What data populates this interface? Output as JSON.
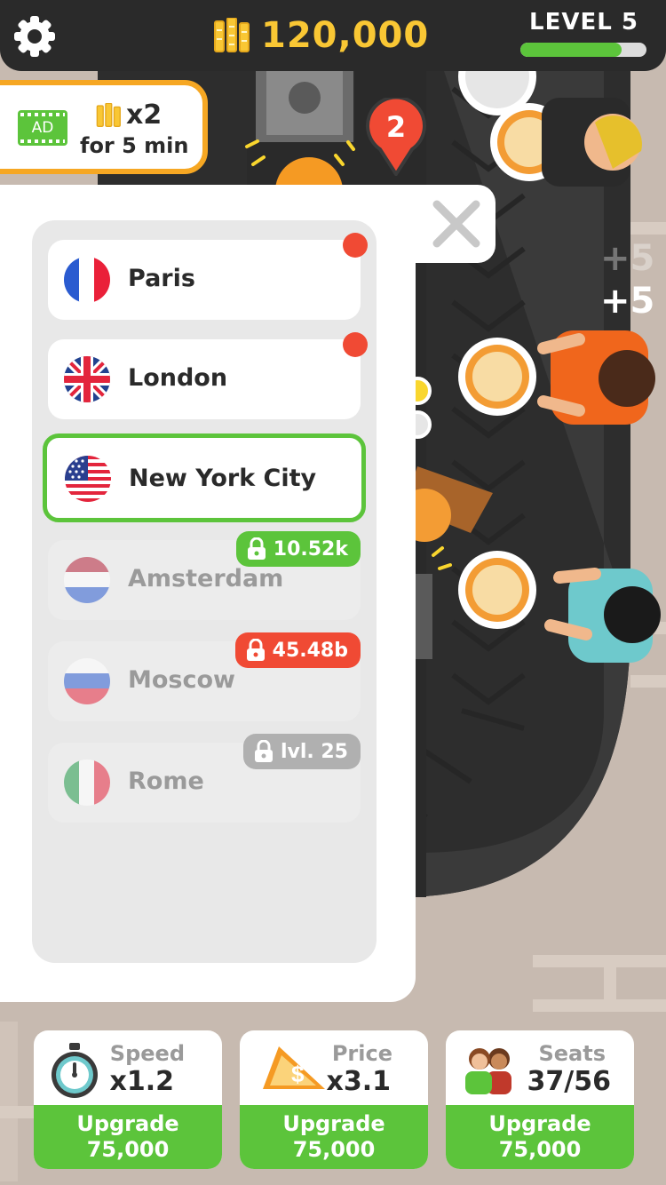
{
  "header": {
    "coins": "120,000",
    "level_label": "LEVEL 5",
    "level_progress": 0.8
  },
  "ad_bonus": {
    "badge": "AD",
    "multiplier": "x2",
    "duration": "for 5 min"
  },
  "notification": {
    "count": "2"
  },
  "cities": [
    {
      "name": "Paris",
      "flag": "france",
      "status": "unlocked",
      "new": true
    },
    {
      "name": "London",
      "flag": "uk",
      "status": "unlocked",
      "new": true
    },
    {
      "name": "New York City",
      "flag": "usa",
      "status": "current"
    },
    {
      "name": "Amsterdam",
      "flag": "netherlands",
      "status": "locked",
      "unlock_text": "10.52k",
      "tag_color": "#5cc43b"
    },
    {
      "name": "Moscow",
      "flag": "russia",
      "status": "locked",
      "unlock_text": "45.48b",
      "tag_color": "#f04a34"
    },
    {
      "name": "Rome",
      "flag": "italy",
      "status": "locked",
      "unlock_text": "lvl. 25",
      "tag_color": "#b0b0b0"
    }
  ],
  "floating_rewards": [
    "+5",
    "+5"
  ],
  "upgrades": {
    "speed": {
      "title": "Speed",
      "value": "x1.2",
      "button_line1": "Upgrade",
      "button_line2": "75,000",
      "icon": "stopwatch-icon"
    },
    "price": {
      "title": "Price",
      "value": "x3.1",
      "button_line1": "Upgrade",
      "button_line2": "75,000",
      "icon": "pizza-slice-icon"
    },
    "seats": {
      "title": "Seats",
      "value": "37/56",
      "button_line1": "Upgrade",
      "button_line2": "75,000",
      "icon": "customers-icon"
    }
  },
  "colors": {
    "accent_green": "#5cc43b",
    "coin_yellow": "#f9c734",
    "ad_border": "#f6a723",
    "alert_red": "#f04a34"
  }
}
